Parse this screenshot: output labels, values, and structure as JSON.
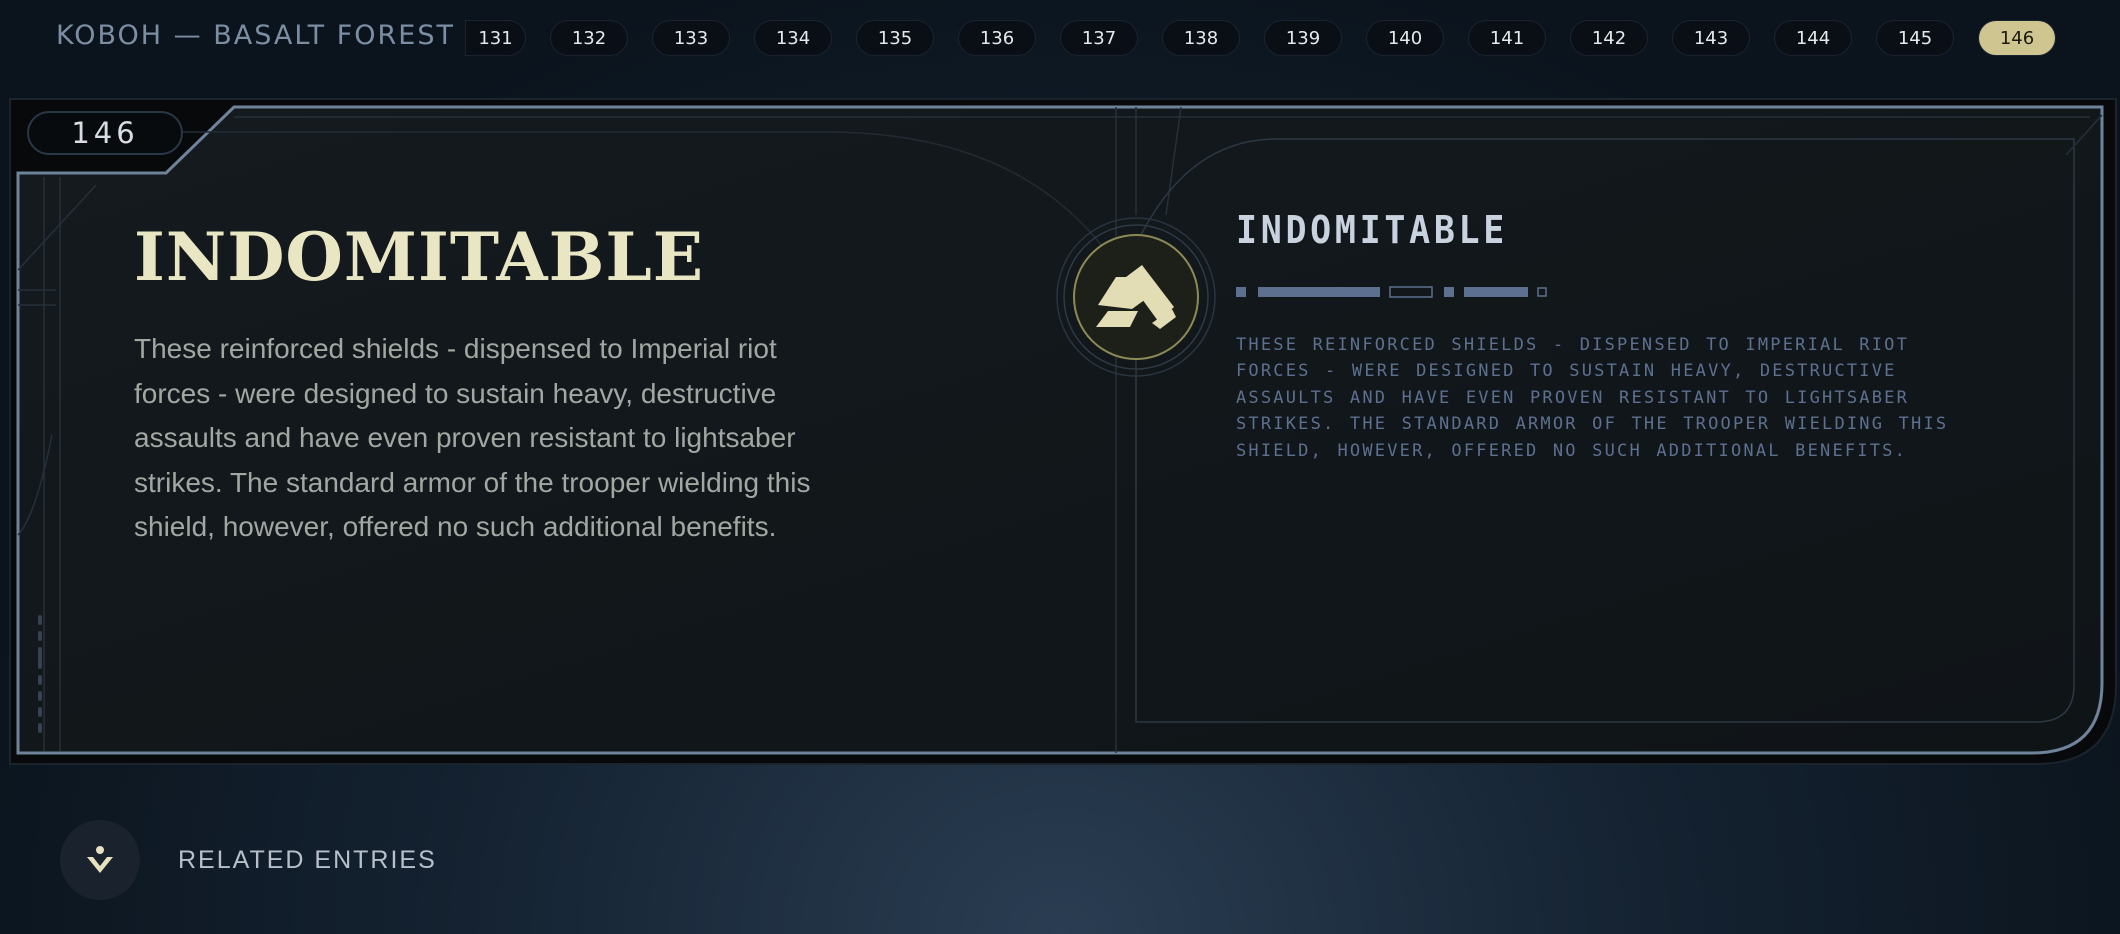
{
  "header": {
    "location": "KOBOH — BASALT FOREST",
    "entries": [
      "131",
      "132",
      "133",
      "134",
      "135",
      "136",
      "137",
      "138",
      "139",
      "140",
      "141",
      "142",
      "143",
      "144",
      "145",
      "146"
    ],
    "active_entry": "146"
  },
  "entry": {
    "number": "146",
    "title": "INDOMITABLE",
    "description": "These reinforced shields - dispensed to Imperial riot forces - were designed to sustain heavy, destructive assaults and have even proven resistant to lightsaber strikes. The standard armor of the trooper wielding this shield, however, offered no such additional benefits.",
    "aurebesh_title": "INDOMITABLE",
    "aurebesh_text": "These reinforced shields - dispensed to Imperial riot forces - were designed to sustain heavy, destructive assaults and have even proven resistant to lightsaber strikes. The standard armor of the trooper wielding this shield, however, offered no such additional benefits.",
    "icon": "riot-shield-icon"
  },
  "footer": {
    "related_label": "RELATED ENTRIES",
    "related_icon": "related-entries-icon"
  },
  "colors": {
    "accent": "#cec590",
    "title": "#e9e6c4",
    "panel_border": "#6f839b",
    "aurebesh": "#5d7090"
  }
}
